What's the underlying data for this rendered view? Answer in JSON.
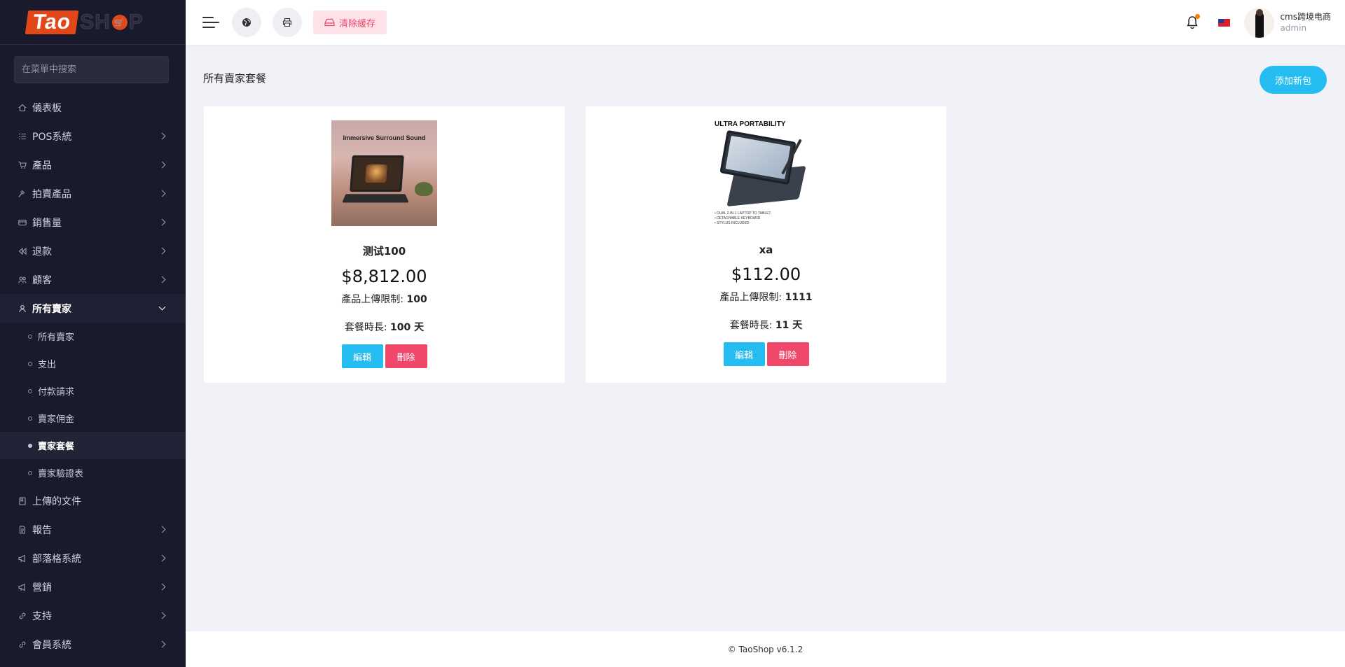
{
  "brand": {
    "logo_part1": "Tao",
    "logo_part2": "SH",
    "logo_part3": "P"
  },
  "sidebar": {
    "search_placeholder": "在菜單中搜索",
    "items": [
      {
        "label": "儀表板",
        "icon": "home-icon",
        "has_children": false
      },
      {
        "label": "POS系統",
        "icon": "list-icon",
        "has_children": true
      },
      {
        "label": "產品",
        "icon": "cart-icon",
        "has_children": true
      },
      {
        "label": "拍賣產品",
        "icon": "gavel-icon",
        "has_children": true
      },
      {
        "label": "銷售量",
        "icon": "credit-card-icon",
        "has_children": true
      },
      {
        "label": "退款",
        "icon": "backward-icon",
        "has_children": true
      },
      {
        "label": "顧客",
        "icon": "users-icon",
        "has_children": true
      },
      {
        "label": "所有賣家",
        "icon": "user-icon",
        "has_children": true,
        "open": true
      }
    ],
    "submenu": [
      {
        "label": "所有賣家"
      },
      {
        "label": "支出"
      },
      {
        "label": "付款請求"
      },
      {
        "label": "賣家佣金"
      },
      {
        "label": "賣家套餐",
        "active": true
      },
      {
        "label": "賣家驗證表"
      }
    ],
    "items_after": [
      {
        "label": "上傳的文件",
        "icon": "folder-icon",
        "has_children": false
      },
      {
        "label": "報告",
        "icon": "file-icon",
        "has_children": true
      },
      {
        "label": "部落格系統",
        "icon": "megaphone-icon",
        "has_children": true
      },
      {
        "label": "營銷",
        "icon": "megaphone-icon",
        "has_children": true
      },
      {
        "label": "支持",
        "icon": "link-icon",
        "has_children": true
      },
      {
        "label": "會員系統",
        "icon": "link-icon",
        "has_children": true
      }
    ]
  },
  "topbar": {
    "clear_cache_label": "清除緩存",
    "user_name": "cms跨境电商",
    "user_role": "admin"
  },
  "main": {
    "page_title": "所有賣家套餐",
    "add_button_label": "添加新包",
    "packages": [
      {
        "image_caption": "Immersive Surround Sound",
        "name": "测试100",
        "price": "$8,812.00",
        "upload_limit_label": "產品上傳限制:",
        "upload_limit_value": "100",
        "duration_label": "套餐時長:",
        "duration_value": "100 天",
        "edit_label": "編輯",
        "delete_label": "刪除"
      },
      {
        "image_caption": "ULTRA PORTABILITY",
        "image_bullets": [
          "• DUAL 2-IN-1 LAPTOP TO TABLET",
          "• DETACHABLE KEYBOARD",
          "• STYLUS INCLUDED"
        ],
        "name": "xa",
        "price": "$112.00",
        "upload_limit_label": "產品上傳限制:",
        "upload_limit_value": "1111",
        "duration_label": "套餐時長:",
        "duration_value": "11 天",
        "edit_label": "編輯",
        "delete_label": "刪除"
      }
    ]
  },
  "footer": {
    "text": "© TaoShop v6.1.2"
  },
  "colors": {
    "sidebar_bg": "#191a2b",
    "accent": "#25bcf1",
    "danger": "#ef486a",
    "clear_cache_bg": "#fde3e8",
    "notification": "#f57c00"
  }
}
